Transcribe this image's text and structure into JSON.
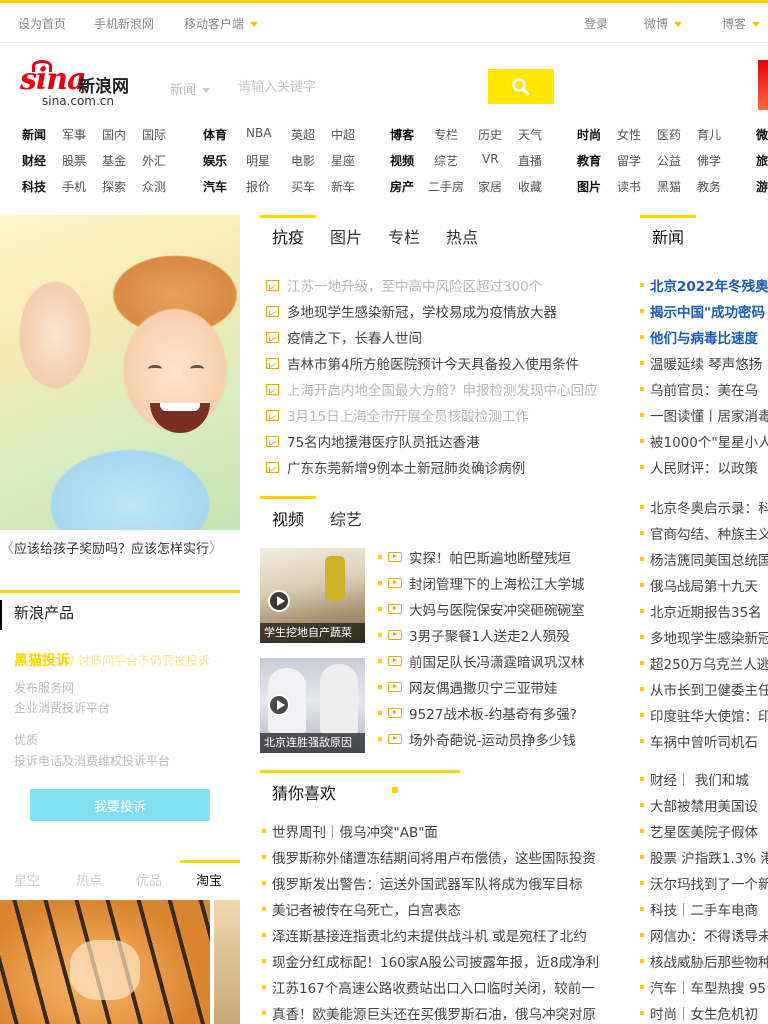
{
  "topbar": {
    "links": [
      "设为首页",
      "手机新浪网",
      "移动客户端"
    ],
    "right": [
      "登录",
      "微博",
      "博客"
    ]
  },
  "logo": {
    "brand": "sina",
    "cn": "新浪网",
    "domain": "sina.com.cn"
  },
  "search": {
    "category": "新闻",
    "placeholder": "请输入关键字"
  },
  "nav": {
    "rows": [
      [
        "新闻",
        "军事",
        "国内",
        "国际",
        "体育",
        "NBA",
        "英超",
        "中超",
        "博客",
        "专栏",
        "历史",
        "天气",
        "时尚",
        "女性",
        "医药",
        "育儿",
        "微"
      ],
      [
        "财经",
        "股票",
        "基金",
        "外汇",
        "娱乐",
        "明星",
        "电影",
        "星座",
        "视频",
        "综艺",
        "VR",
        "直播",
        "教育",
        "留学",
        "公益",
        "佛学",
        "旅"
      ],
      [
        "科技",
        "手机",
        "探索",
        "众测",
        "汽车",
        "报价",
        "买车",
        "新车",
        "房产",
        "二手房",
        "家居",
        "收藏",
        "图片",
        "读书",
        "黑猫",
        "教务",
        "游"
      ]
    ]
  },
  "hero": {
    "caption": "应该给孩子奖励吗？应该怎样实行"
  },
  "products": {
    "title": "新浪产品",
    "heimao": "黑猫投诉",
    "heimao_tag": "/ 讨债问平台不仍罚被投诉",
    "lines": [
      "发布服务网",
      "企业消费投诉平台",
      "优质",
      "投诉电话及消费维权投诉平台"
    ],
    "button": "我要投诉"
  },
  "shop": {
    "tabs": [
      "星空",
      "热点",
      "优品",
      "淘宝"
    ]
  },
  "center": {
    "tabs": [
      "抗疫",
      "图片",
      "专栏",
      "热点"
    ],
    "news": [
      "江苏一地升级，至中高中风险区超过300个",
      "多地现学生感染新冠，学校易成为疫情放大器",
      "疫情之下，长春人世间",
      "吉林市第4所方舱医院预计今天具备投入使用条件",
      "上海开启内地全国最大方舱？申报检测发现中心回应",
      "3月15日上海全市开展全员核酸检测工作",
      "75名内地援港医疗队员抵达香港",
      "广东东莞新增9例本土新冠肺炎确诊病例"
    ],
    "video_tabs": [
      "视频",
      "综艺"
    ],
    "video_thumbs": [
      "学生挖地自产蔬菜",
      "北京连胜强敌原因"
    ],
    "videos": [
      "实探！帕巴斯遍地断壁残垣",
      "封闭管理下的上海松江大学城",
      "大妈与医院保安冲突砸碗碗室",
      "3男子聚餐1人送走2人殒殁",
      "前国足队长冯潇霆暗讽巩汉林",
      "网友偶遇撒贝宁三亚带娃",
      "9527战术板-约基奇有多强?",
      "场外奇葩说-运动员挣多少钱"
    ],
    "guess_title": "猜你喜欢",
    "guess": [
      "世界周刊｜俄乌冲突\"AB\"面",
      "俄罗斯称外储遭冻结期间将用卢布偿债，这些国际投资",
      "俄罗斯发出警告：运送外国武器军队将成为俄军目标",
      "美记者被传在乌死亡，白宫表态",
      "泽连斯基接连指责北约未提供战斗机 或是宛枉了北约",
      "现金分红成标配！160家A股公司披露年报，近8成净利",
      "江苏167个高速公路收费站出口入口临时关闭，较前一",
      "真香！欧美能源巨头还在买俄罗斯石油，俄乌冲突对原"
    ]
  },
  "right": {
    "tab": "新闻",
    "headlines": [
      "北京2022年冬残奥会",
      "揭示中国\"成功密码",
      "他们与病毒比速度"
    ],
    "news1": [
      "温暖延续 琴声悠扬",
      "乌前官员：美在乌",
      "一图读懂丨居家消毒",
      "被1000个\"星星小人",
      "人民财评：以政策"
    ],
    "news2": [
      "北京冬奥启示录：科",
      "官商勾结、种族主义",
      "杨洁篪同美国总统国",
      "俄乌战局第十九天",
      "北京近期报告35名",
      "多地现学生感染新冠",
      "超250万乌克兰人逃",
      "从市长到卫健委主任",
      "印度驻华大使馆：印",
      "车祸中曾听司机石"
    ],
    "news3": [
      "财经｜ 我们和城",
      "大部被禁用美国设",
      "艺星医美院子假体",
      "股票 沪指跌1.3% 港",
      "沃尔玛找到了一个新",
      "科技｜二手车电商",
      "网信办：不得诱导未",
      "核战威胁后那些物种",
      "汽车｜车型热搜 95",
      "时尚｜女生危机初"
    ]
  }
}
